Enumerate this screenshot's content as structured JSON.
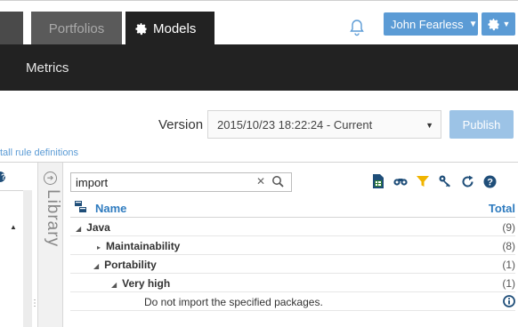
{
  "nav": {
    "tabs": [
      {
        "label": "Portfolios",
        "active": false
      },
      {
        "label": "Models",
        "active": true,
        "icon": "gear-icon"
      }
    ],
    "notifications_icon": "bell-icon",
    "user_menu": {
      "label": "John Fearless"
    },
    "settings_menu": {
      "icon": "gear-icon"
    }
  },
  "subheader": {
    "title": "Metrics"
  },
  "version": {
    "label": "Version",
    "selected": "2015/10/23 18:22:24 - Current",
    "publish_label": "Publish"
  },
  "install_link": "tall rule definitions",
  "library": {
    "label": "Library",
    "icon": "circle-arrow-right-icon"
  },
  "search": {
    "value": "import"
  },
  "toolbar_icons": [
    "export-icon",
    "binoculars-icon",
    "filter-icon",
    "keys-icon",
    "refresh-icon",
    "help-icon"
  ],
  "table": {
    "header": {
      "name": "Name",
      "total": "Total"
    },
    "rows": [
      {
        "label": "Java",
        "count": "(9)",
        "expanded": true,
        "level": 0
      },
      {
        "label": "Maintainability",
        "count": "(8)",
        "expanded": false,
        "level": 1
      },
      {
        "label": "Portability",
        "count": "(1)",
        "expanded": true,
        "level": 1
      },
      {
        "label": "Very high",
        "count": "(1)",
        "expanded": true,
        "level": 2
      },
      {
        "label": "Do not import the specified packages.",
        "count": "",
        "level": 3
      }
    ]
  },
  "colors": {
    "accent": "#5b9bd5",
    "dark_bar": "#222222",
    "link": "#2e7bbf",
    "filter_icon": "#f0b400"
  }
}
